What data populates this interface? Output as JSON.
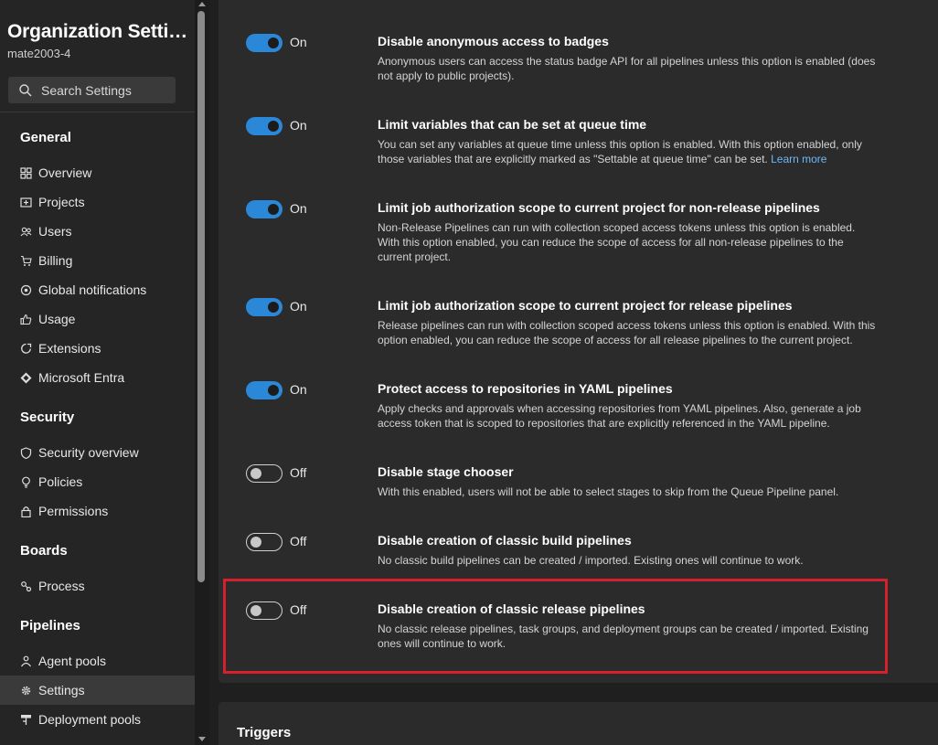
{
  "sidebar": {
    "org_title": "Organization Settin...",
    "org_name": "mate2003-4",
    "search_label": "Search Settings",
    "sections": {
      "general": "General",
      "security": "Security",
      "boards": "Boards",
      "pipelines": "Pipelines"
    },
    "general_items": [
      "Overview",
      "Projects",
      "Users",
      "Billing",
      "Global notifications",
      "Usage",
      "Extensions",
      "Microsoft Entra"
    ],
    "security_items": [
      "Security overview",
      "Policies",
      "Permissions"
    ],
    "boards_items": [
      "Process"
    ],
    "pipelines_items": [
      "Agent pools",
      "Settings",
      "Deployment pools"
    ],
    "selected_item": "Settings"
  },
  "settings": [
    {
      "state": "On",
      "title": "Disable anonymous access to badges",
      "desc": "Anonymous users can access the status badge API for all pipelines unless this option is enabled (does not apply to public projects)."
    },
    {
      "state": "On",
      "title": "Limit variables that can be set at queue time",
      "desc": "You can set any variables at queue time unless this option is enabled. With this option enabled, only those variables that are explicitly marked as \"Settable at queue time\" can be set.",
      "link": "Learn more"
    },
    {
      "state": "On",
      "title": "Limit job authorization scope to current project for non-release pipelines",
      "desc": "Non-Release Pipelines can run with collection scoped access tokens unless this option is enabled. With this option enabled, you can reduce the scope of access for all non-release pipelines to the current project."
    },
    {
      "state": "On",
      "title": "Limit job authorization scope to current project for release pipelines",
      "desc": "Release pipelines can run with collection scoped access tokens unless this option is enabled. With this option enabled, you can reduce the scope of access for all release pipelines to the current project."
    },
    {
      "state": "On",
      "title": "Protect access to repositories in YAML pipelines",
      "desc": "Apply checks and approvals when accessing repositories from YAML pipelines. Also, generate a job access token that is scoped to repositories that are explicitly referenced in the YAML pipeline."
    },
    {
      "state": "Off",
      "title": "Disable stage chooser",
      "desc": "With this enabled, users will not be able to select stages to skip from the Queue Pipeline panel."
    },
    {
      "state": "Off",
      "title": "Disable creation of classic build pipelines",
      "desc": "No classic build pipelines can be created / imported. Existing ones will continue to work."
    },
    {
      "state": "Off",
      "title": "Disable creation of classic release pipelines",
      "desc": "No classic release pipelines, task groups, and deployment groups can be created / imported. Existing ones will continue to work."
    }
  ],
  "triggers_title": "Triggers",
  "colors": {
    "toggle_on": "#2b88d8",
    "link": "#6cb8f6",
    "highlight": "#d6202c",
    "sidebar_bg": "#252525",
    "card_bg": "#2b2b2b"
  },
  "icons": {
    "search": "search-icon",
    "overview": "grid-icon",
    "projects": "projects-icon",
    "users": "users-icon",
    "billing": "cart-icon",
    "notifications": "notification-icon",
    "usage": "thumbs-up-icon",
    "extensions": "puzzle-icon",
    "entra": "diamond-icon",
    "security_overview": "shield-icon",
    "policies": "lightbulb-icon",
    "permissions": "lock-icon",
    "process": "process-icon",
    "agent_pools": "agent-pool-icon",
    "settings": "gear-icon",
    "deployment_pools": "deployment-icon"
  }
}
